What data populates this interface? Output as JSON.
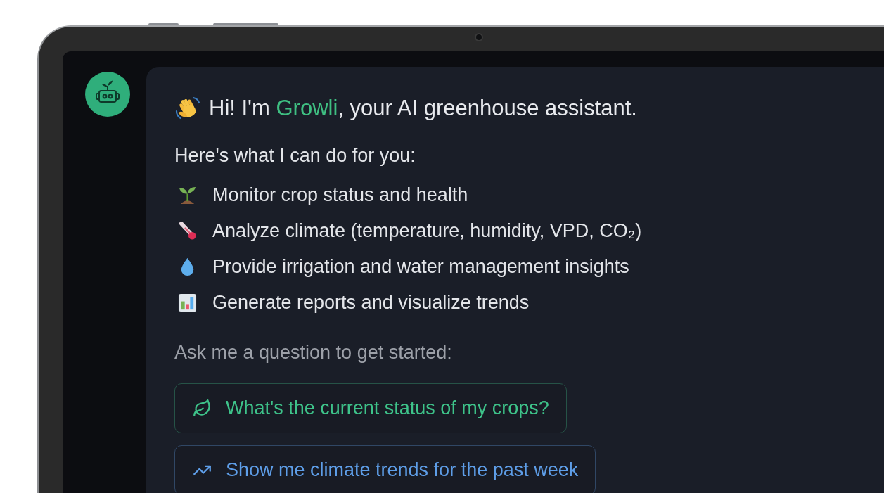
{
  "assistant_message": {
    "greeting": {
      "before": "Hi! I'm",
      "name": "Growli",
      "after": ", your AI greenhouse assistant."
    },
    "intro": "Here's what I can do for you:",
    "capabilities": [
      {
        "kind": "seedling",
        "text": "Monitor crop status and health"
      },
      {
        "kind": "thermometer",
        "text": "Analyze climate (temperature, humidity, VPD, CO₂)"
      },
      {
        "kind": "droplet",
        "text": "Provide irrigation and water management insights"
      },
      {
        "kind": "chart",
        "text": "Generate reports and visualize trends"
      }
    ],
    "prompt": "Ask me a question to get started:",
    "suggestions": [
      {
        "kind": "leaf",
        "color": "#3ec38a",
        "text": "What's the current status of my crops?"
      },
      {
        "kind": "trend",
        "color": "#5e9ee8",
        "text": "Show me climate trends for the past week"
      }
    ]
  }
}
